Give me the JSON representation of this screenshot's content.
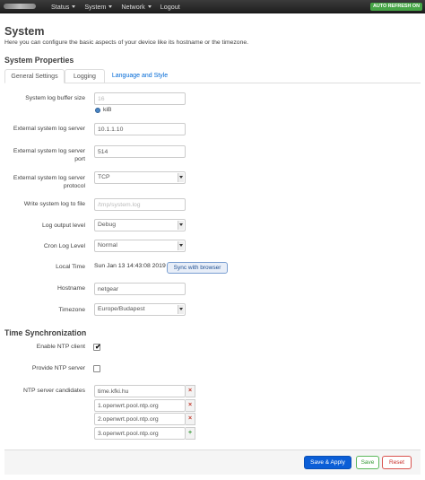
{
  "topbar": {
    "nav": [
      {
        "label": "Status"
      },
      {
        "label": "System"
      },
      {
        "label": "Network"
      },
      {
        "label": "Logout"
      }
    ],
    "auto_refresh": "AUTO REFRESH ON"
  },
  "page": {
    "title": "System",
    "description": "Here you can configure the basic aspects of your device like its hostname or the timezone."
  },
  "properties": {
    "title": "System Properties",
    "tabs": [
      "General Settings",
      "Logging",
      "Language and Style"
    ],
    "log_buffer": {
      "label": "System log buffer size",
      "placeholder": "16",
      "unit": "kiB"
    },
    "external_server": {
      "label": "External system log server",
      "value": "10.1.1.10"
    },
    "external_port": {
      "label": "External system log server port",
      "value": "514"
    },
    "external_protocol": {
      "label": "External system log server protocol",
      "value": "TCP"
    },
    "log_file": {
      "label": "Write system log to file",
      "placeholder": "/tmp/system.log"
    },
    "log_level": {
      "label": "Log output level",
      "value": "Debug"
    },
    "cron_level": {
      "label": "Cron Log Level",
      "value": "Normal"
    },
    "local_time": {
      "label": "Local Time",
      "value": "Sun Jan 13 14:43:08 2019",
      "sync_label": "Sync with browser"
    },
    "hostname": {
      "label": "Hostname",
      "value": "netgear"
    },
    "timezone": {
      "label": "Timezone",
      "value": "Europe/Budapest"
    }
  },
  "ntp": {
    "title": "Time Synchronization",
    "enable": {
      "label": "Enable NTP client",
      "checked_glyph": "✔"
    },
    "provide": {
      "label": "Provide NTP server"
    },
    "candidates_label": "NTP server candidates",
    "servers": [
      "time.kfki.hu",
      "1.openwrt.pool.ntp.org",
      "2.openwrt.pool.ntp.org",
      "3.openwrt.pool.ntp.org"
    ],
    "remove_glyph": "×",
    "add_glyph": "+"
  },
  "footer": {
    "save_apply": "Save & Apply",
    "save": "Save",
    "reset": "Reset"
  }
}
